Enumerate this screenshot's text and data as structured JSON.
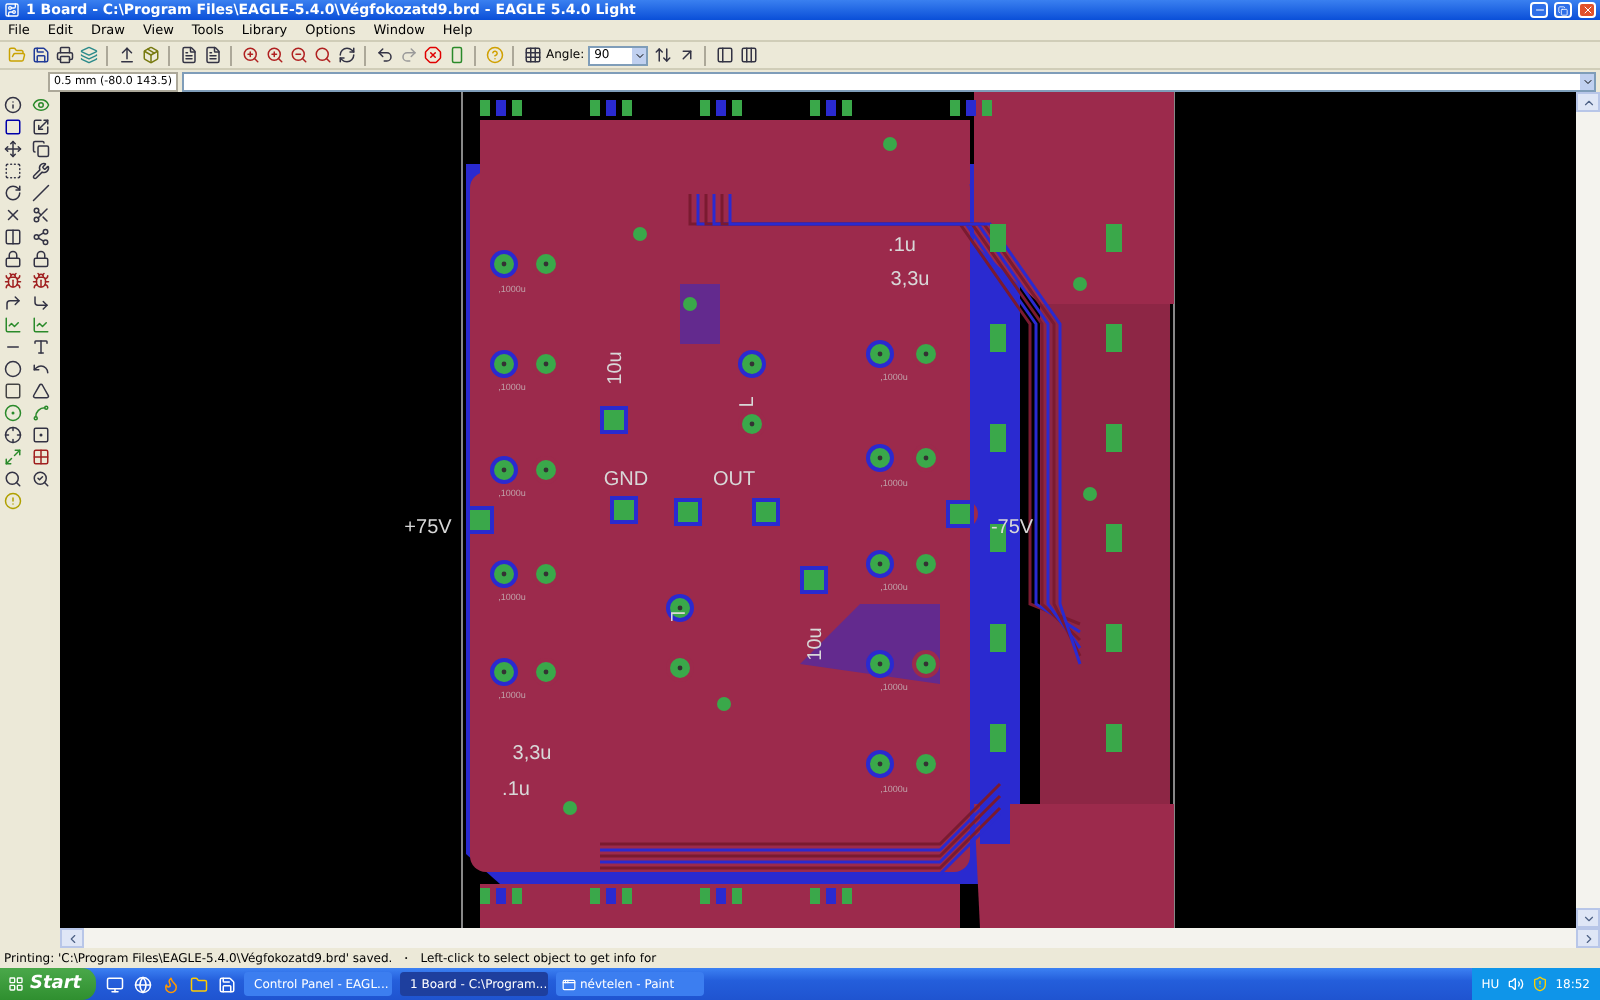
{
  "window": {
    "title": "1 Board - C:\\Program Files\\EAGLE-5.4.0\\Végfokozatd9.brd - EAGLE 5.4.0 Light"
  },
  "menu": [
    "File",
    "Edit",
    "Draw",
    "View",
    "Tools",
    "Library",
    "Options",
    "Window",
    "Help"
  ],
  "toolbar": {
    "angle_label": "Angle:",
    "angle_value": "90"
  },
  "command_line": {
    "coordinates": "0.5 mm (-80.0 143.5)"
  },
  "board": {
    "labels": [
      ".1u",
      ",1000u",
      "3,3u",
      "10u",
      ",1000u",
      ",1000u",
      "L",
      "GND",
      "OUT",
      ",1000u",
      ",1000u",
      "+75V",
      "-75V",
      ",1000u",
      ",1000u",
      "L",
      "10u",
      ",1000u",
      ",1000u",
      "3,3u",
      ".1u",
      ",1000u"
    ]
  },
  "status_bar": {
    "message": "Printing: 'C:\\Program Files\\EAGLE-5.4.0\\Végfokozatd9.brd' saved.",
    "hint": "Left-click to select object to get info for"
  },
  "taskbar": {
    "start": "Start",
    "tasks": [
      {
        "label": "Control Panel - EAGL...",
        "selected": false
      },
      {
        "label": "1 Board - C:\\Program...",
        "selected": true
      },
      {
        "label": "névtelen - Paint",
        "selected": false
      }
    ],
    "language": "HU",
    "clock": "18:52"
  }
}
